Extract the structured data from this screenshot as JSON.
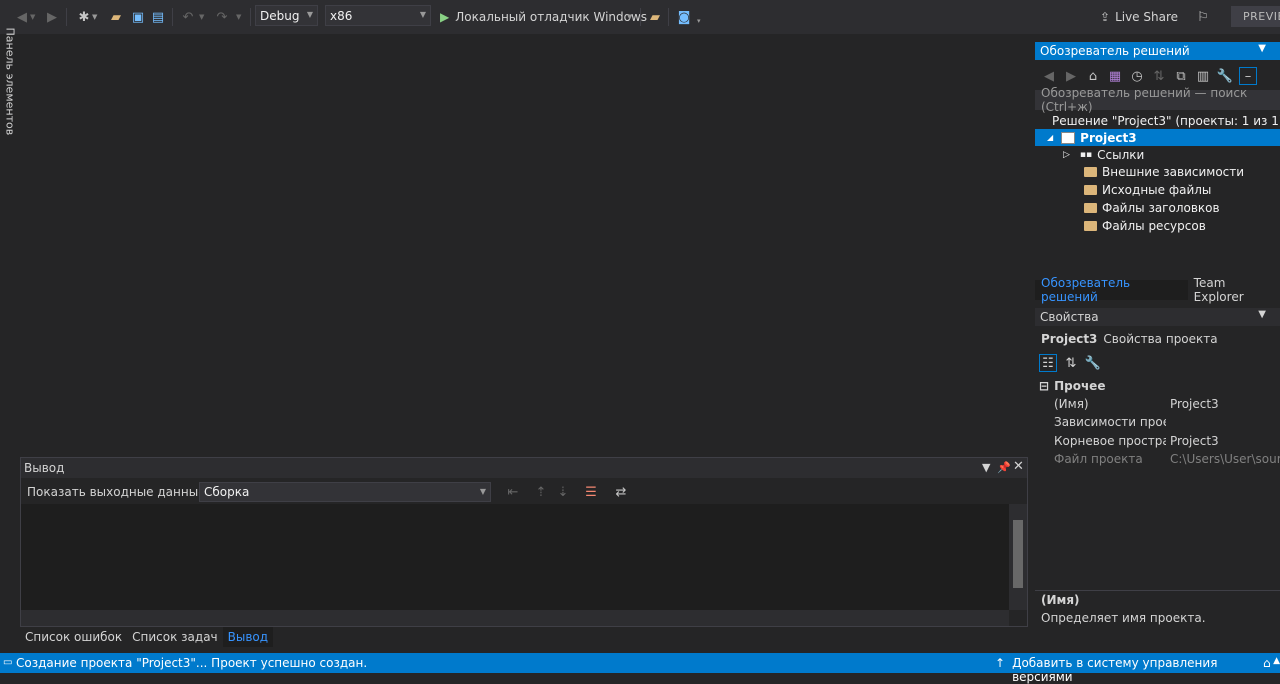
{
  "toolbar": {
    "config": "Debug",
    "platform": "x86",
    "run_label": "Локальный отладчик Windows",
    "live_share": "Live Share",
    "preview": "PREVIEW"
  },
  "toolbox_tab": "Панель элементов",
  "solution_explorer": {
    "title": "Обозреватель решений",
    "search_placeholder": "Обозреватель решений — поиск (Ctrl+ж)",
    "solution": "Решение \"Project3\" (проекты: 1 из 1)",
    "project": "Project3",
    "items": [
      "Ссылки",
      "Внешние зависимости",
      "Исходные файлы",
      "Файлы заголовков",
      "Файлы ресурсов"
    ],
    "tabs": [
      "Обозреватель решений",
      "Team Explorer"
    ]
  },
  "properties": {
    "title": "Свойства",
    "object_name": "Project3",
    "object_type": "Свойства проекта",
    "category": "Прочее",
    "rows": [
      {
        "key": "(Имя)",
        "value": "Project3"
      },
      {
        "key": "Зависимости проект",
        "value": ""
      },
      {
        "key": "Корневое пространс",
        "value": "Project3"
      },
      {
        "key": "Файл проекта",
        "value": "C:\\Users\\User\\source\\"
      }
    ],
    "desc_title": "(Имя)",
    "desc_text": "Определяет имя проекта."
  },
  "output": {
    "title": "Вывод",
    "show_label": "Показать выходные данные из:",
    "source": "Сборка"
  },
  "bottom_tabs": [
    "Список ошибок",
    "Список задач",
    "Вывод"
  ],
  "status": {
    "message": "Создание проекта \"Project3\"... Проект успешно создан.",
    "source_control": "Добавить в систему управления версиями"
  },
  "colors": {
    "accent": "#007acc",
    "background": "#252526",
    "toolbar": "#2d2d30"
  }
}
